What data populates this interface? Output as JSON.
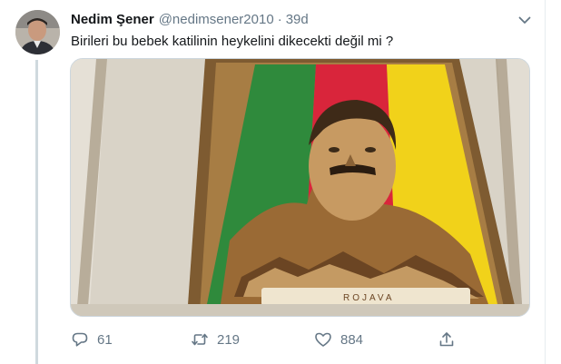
{
  "tweet": {
    "display_name": "Nedim Şener",
    "handle": "@nedimsener2010",
    "separator": "·",
    "time": "39d",
    "text": "Birileri bu bebek katilinin heykelini dikecekti değil mi ?",
    "media_caption": "ROJAVA",
    "actions": {
      "reply_count": "61",
      "retweet_count": "219",
      "like_count": "884"
    }
  },
  "icons": {
    "more": "chevron-down-icon",
    "reply": "reply-icon",
    "retweet": "retweet-icon",
    "like": "heart-icon",
    "share": "share-icon"
  },
  "colors": {
    "text": "#14171a",
    "secondary": "#657786",
    "flag_green": "#2f8a3c",
    "flag_red": "#d9253b",
    "flag_yellow": "#f1d21a"
  }
}
